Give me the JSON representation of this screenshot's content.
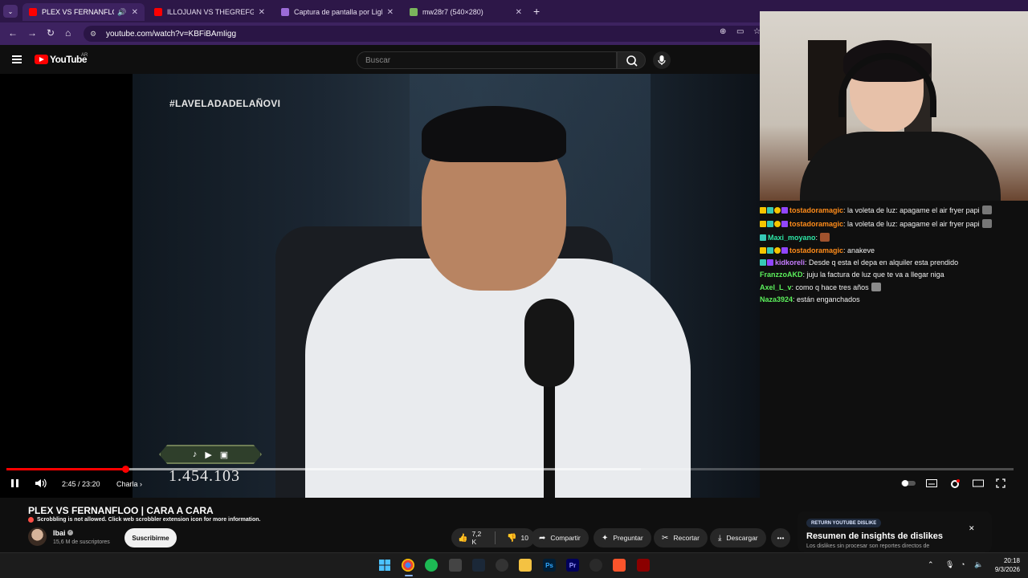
{
  "browser": {
    "tabs": [
      {
        "label": "PLEX VS FERNANFLOO | CA",
        "active": true,
        "favicon_color": "#ff0000",
        "audio": true
      },
      {
        "label": "ILLOJUAN VS THEGREFG | CAR",
        "active": false,
        "favicon_color": "#ff0000"
      },
      {
        "label": "Captura de pantalla por Lightsh",
        "active": false,
        "favicon_color": "#9b6bd6"
      },
      {
        "label": "mw28r7 (540×280)",
        "active": false,
        "favicon_color": "#7ab55c"
      }
    ],
    "url": "youtube.com/watch?v=KBFiBAmIigg",
    "theme_color": "#3d2260"
  },
  "youtube": {
    "logo_text": "YouTube",
    "region": "AR",
    "search_placeholder": "Buscar"
  },
  "video": {
    "overlay_hashtag": "#LAVELADADELAÑOVI",
    "overlay_count": "1.454.103",
    "time": "2:45 / 23:20",
    "chapter": "Charla",
    "progress_played_fraction": 0.118,
    "progress_buffered_fraction": 0.63,
    "accent": "#ff0000"
  },
  "chat": [
    {
      "user": "tostadoramagic",
      "color": "#ff8c1a",
      "text": ": la voleta de luz: apagame el air fryer papi",
      "badges": [
        "#f5c400",
        "#37c9b5",
        "#f5c400",
        "#9146ff"
      ],
      "emote": "#777"
    },
    {
      "user": "tostadoramagic",
      "color": "#ff8c1a",
      "text": ": la voleta de luz: apagame el air fryer papi",
      "badges": [
        "#f5c400",
        "#37c9b5",
        "#f5c400",
        "#9146ff"
      ],
      "emote": "#777"
    },
    {
      "user": "Maxi_moyano",
      "color": "#2ee6a6",
      "text": ":",
      "badges": [
        "#37c9b5"
      ],
      "emote": "#a0522d"
    },
    {
      "user": "tostadoramagic",
      "color": "#ff8c1a",
      "text": ": anakeve",
      "badges": [
        "#f5c400",
        "#37c9b5",
        "#f5c400",
        "#9146ff"
      ]
    },
    {
      "user": "kidkoreli",
      "color": "#c77dff",
      "text": ": Desde q esta el depa en alquiler esta prendido",
      "badges": [
        "#37c9b5",
        "#9146ff"
      ]
    },
    {
      "user": "FranzzoAKD",
      "color": "#5cf05c",
      "text": ": juju la factura de luz que te va a llegar niga",
      "badges": []
    },
    {
      "user": "Axel_L_v",
      "color": "#5cf05c",
      "text": ": como q hace tres años",
      "badges": [],
      "emote": "#8a8a8a"
    },
    {
      "user": "Naza3924",
      "color": "#5cf05c",
      "text": ": están enganchados",
      "badges": []
    }
  ],
  "info": {
    "title": "PLEX VS FERNANFLOO | CARA A CARA",
    "scrobble": "Scrobbling is not allowed. Click web scrobbler extension icon for more information.",
    "channel": "Ibai",
    "subscribers": "15,6 M de suscriptores",
    "subscribe_label": "Suscribirme",
    "likes": "7,2 K",
    "dislikes": "10",
    "share": "Compartir",
    "ask": "Preguntar",
    "clip": "Recortar",
    "download": "Descargar"
  },
  "return_dislike": {
    "badge": "RETURN YOUTUBE DISLIKE",
    "title": "Resumen de insights de dislikes",
    "body": "Los dislikes sin procesar son reportes directos de"
  },
  "taskbar": {
    "time": "20:18",
    "date": "9/3/2026"
  }
}
